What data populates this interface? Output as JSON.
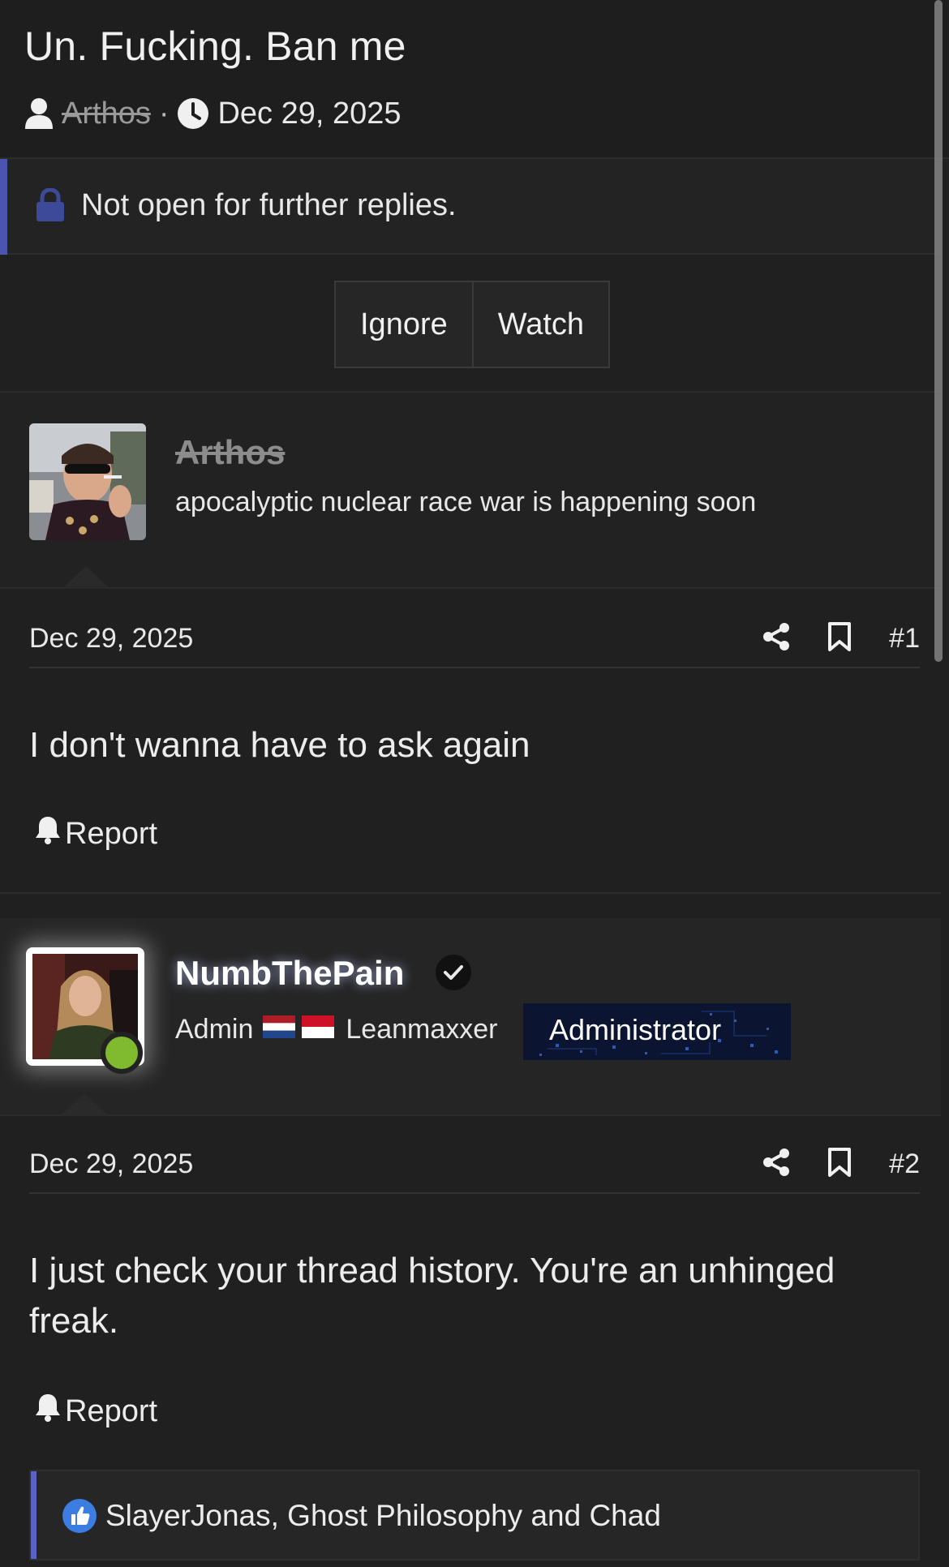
{
  "thread": {
    "title": "Un. Fucking. Ban me",
    "author": "Arthos",
    "separator": "·",
    "date": "Dec 29, 2025"
  },
  "notice": {
    "text": "Not open for further replies."
  },
  "buttons": {
    "ignore": "Ignore",
    "watch": "Watch"
  },
  "posts": [
    {
      "username": "Arthos",
      "user_title": "apocalyptic nuclear race war is happening soon",
      "date": "Dec 29, 2025",
      "number": "#1",
      "body": "I don't wanna have to ask again",
      "report": "Report"
    },
    {
      "username": "NumbThePain",
      "user_title_left": "Admin",
      "user_title_right": "Leanmaxxer",
      "badge": "Administrator",
      "date": "Dec 29, 2025",
      "number": "#2",
      "body": "I just check your thread history. You're an unhinged freak.",
      "report": "Report",
      "reactions": "SlayerJonas, Ghost Philosophy and Chad"
    }
  ],
  "colors": {
    "accent": "#4b55b0",
    "online": "#7fba2f",
    "background": "#202020"
  }
}
